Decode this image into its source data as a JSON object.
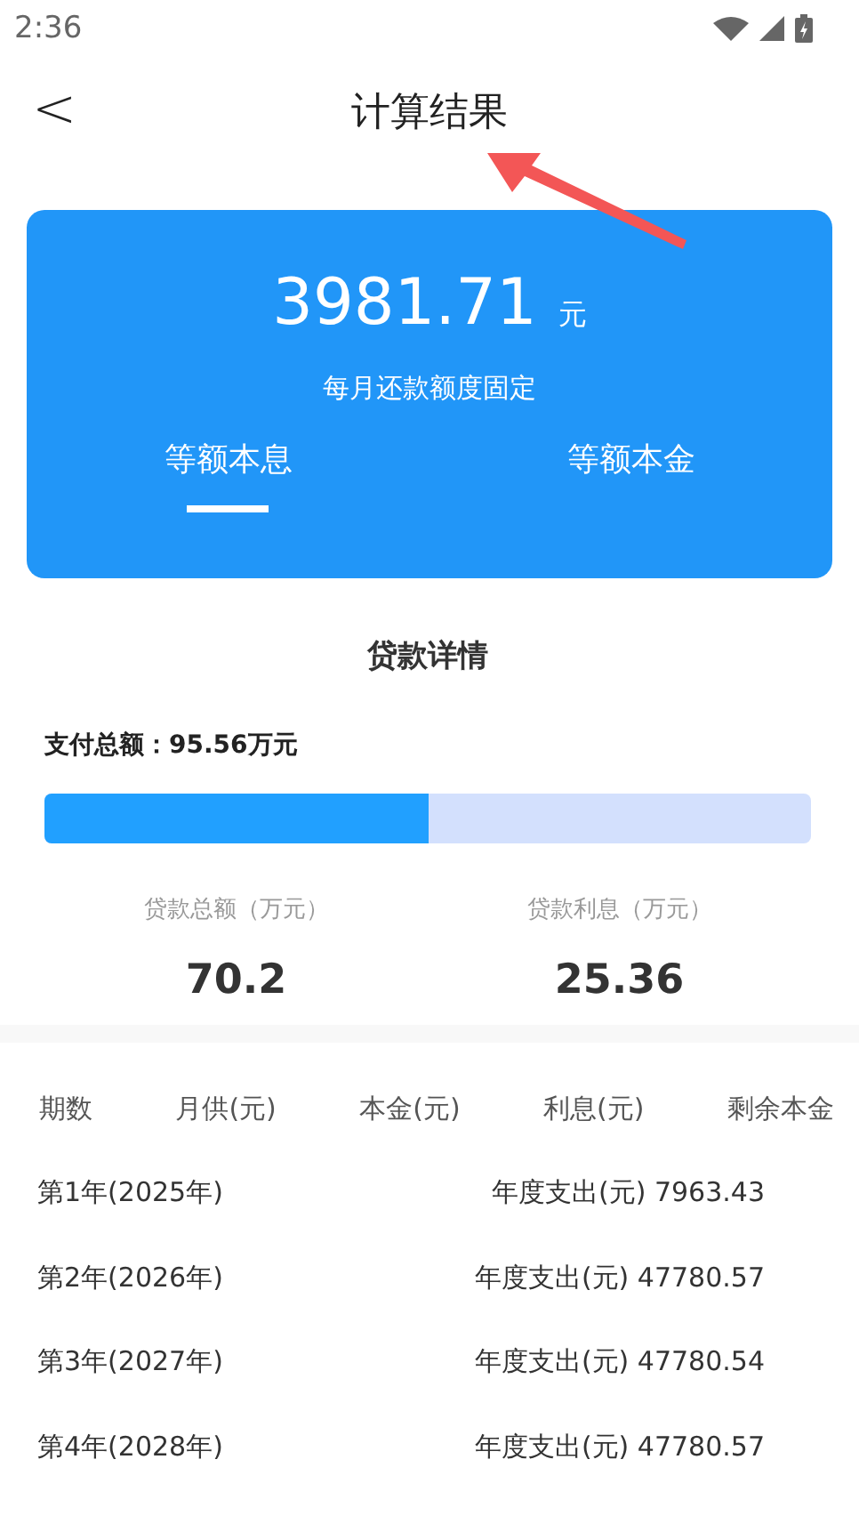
{
  "status_bar": {
    "time": "2:36"
  },
  "header": {
    "back": "<",
    "title": "计算结果"
  },
  "summary": {
    "amount": "3981.71",
    "unit": "元",
    "note": "每月还款额度固定",
    "tabs": [
      {
        "label": "等额本息",
        "selected": true
      },
      {
        "label": "等额本金",
        "selected": false
      }
    ]
  },
  "details": {
    "title": "贷款详情",
    "total": "支付总额：95.56万元",
    "level": 0.5,
    "stats": [
      {
        "label": "贷款总额（万元）",
        "value": "70.2"
      },
      {
        "label": "贷款利息（万元）",
        "value": "25.36"
      }
    ]
  },
  "table": {
    "columns": [
      "期数",
      "月供(元)",
      "本金(元)",
      "利息(元)",
      "剩余本金"
    ],
    "rows": [
      {
        "period": "第1年(2025年)",
        "spend": "年度支出(元) 7963.43"
      },
      {
        "period": "第2年(2026年)",
        "spend": "年度支出(元) 47780.57"
      },
      {
        "period": "第3年(2027年)",
        "spend": "年度支出(元) 47780.54"
      },
      {
        "period": "第4年(2028年)",
        "spend": "年度支出(元) 47780.57"
      }
    ]
  }
}
